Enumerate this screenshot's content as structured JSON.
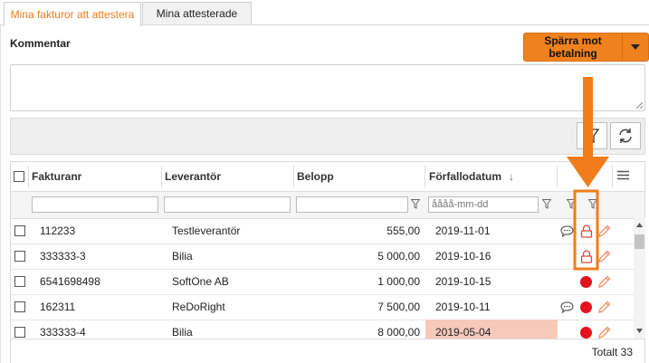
{
  "tabs": [
    {
      "label": "Mina fakturor att attestera",
      "active": true
    },
    {
      "label": "Mina attesterade",
      "active": false
    }
  ],
  "comment_label": "Kommentar",
  "action_button": {
    "label": "Spärra mot betalning"
  },
  "columns": {
    "fakturanr": "Fakturanr",
    "leverantor": "Leverantör",
    "belopp": "Belopp",
    "forfallodatum": "Förfallodatum",
    "sort_arrow": "↓"
  },
  "filters": {
    "date_placeholder": "åååå-mm-dd"
  },
  "rows": [
    {
      "fakturanr": "112233",
      "leverantor": "Testleverantör",
      "belopp": "555,00",
      "datum": "2019-11-01",
      "comment": true,
      "status": "lock",
      "overdue": false
    },
    {
      "fakturanr": "333333-3",
      "leverantor": "Bilia",
      "belopp": "5 000,00",
      "datum": "2019-10-16",
      "comment": false,
      "status": "lock",
      "overdue": false
    },
    {
      "fakturanr": "6541698498",
      "leverantor": "SoftOne AB",
      "belopp": "1 000,00",
      "datum": "2019-10-15",
      "comment": false,
      "status": "red-dot",
      "overdue": false
    },
    {
      "fakturanr": "162311",
      "leverantor": "ReDoRight",
      "belopp": "7 500,00",
      "datum": "2019-10-11",
      "comment": true,
      "status": "red-dot",
      "overdue": false
    },
    {
      "fakturanr": "333333-4",
      "leverantor": "Bilia",
      "belopp": "8 000,00",
      "datum": "2019-05-04",
      "comment": false,
      "status": "red-dot",
      "overdue": true
    }
  ],
  "footer": {
    "total": "Totalt 33"
  },
  "colors": {
    "accent": "#f07d1a",
    "button": "#f0821e",
    "lock": "#e0443c",
    "status_red": "#e3131d",
    "overdue_bg": "#f7c9bb",
    "annotation": "#f07d1a"
  }
}
